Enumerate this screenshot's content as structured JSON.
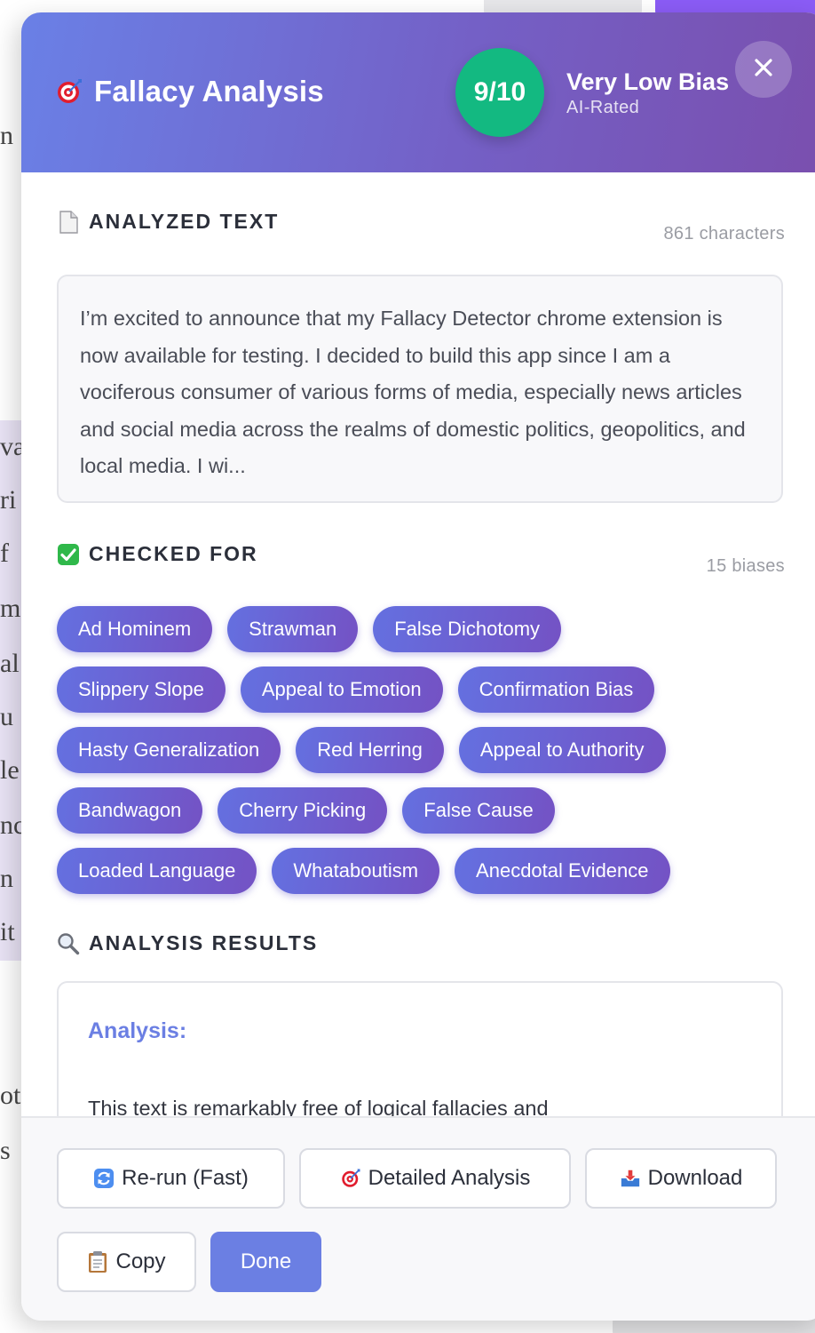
{
  "background": {
    "fragments": [
      "n",
      "va",
      "ri",
      "f",
      "m",
      "al",
      "u",
      "le",
      "nc",
      "n",
      "it",
      "ot",
      "s"
    ]
  },
  "modal": {
    "title": "Fallacy Analysis",
    "title_icon": "target-icon",
    "score": "9/10",
    "bias_label": "Very Low Bias",
    "bias_sub": "AI-Rated",
    "close_icon": "close-icon"
  },
  "analyzed": {
    "title": "ANALYZED TEXT",
    "icon": "document-icon",
    "meta": "861 characters",
    "text": "I’m excited to announce that my Fallacy Detector chrome extension is now available for testing. I decided to build this app since I am a vociferous consumer of various forms of media, especially news articles and social media across the realms of domestic politics, geopolitics, and local media. I wi..."
  },
  "checked": {
    "title": "CHECKED FOR",
    "icon": "check-icon",
    "meta": "15 biases",
    "rows": [
      [
        "Ad Hominem",
        "Strawman",
        "False Dichotomy"
      ],
      [
        "Slippery Slope",
        "Appeal to Emotion",
        "Confirmation Bias"
      ],
      [
        "Hasty Generalization",
        "Red Herring",
        "Appeal to Authority"
      ],
      [
        "Bandwagon",
        "Cherry Picking",
        "False Cause"
      ],
      [
        "Loaded Language",
        "Whataboutism",
        "Anecdotal Evidence"
      ]
    ]
  },
  "results": {
    "title": "ANALYSIS RESULTS",
    "icon": "magnifier-icon",
    "heading": "Analysis:",
    "text": "This text is remarkably free of logical fallacies and"
  },
  "footer": {
    "rerun": "Re-run (Fast)",
    "detailed": "Detailed Analysis",
    "download": "Download",
    "copy": "Copy",
    "done": "Done"
  },
  "colors": {
    "header_start": "#6a80e6",
    "header_end": "#7a4fae",
    "score_green": "#13b981",
    "accent": "#6b7fe3"
  }
}
